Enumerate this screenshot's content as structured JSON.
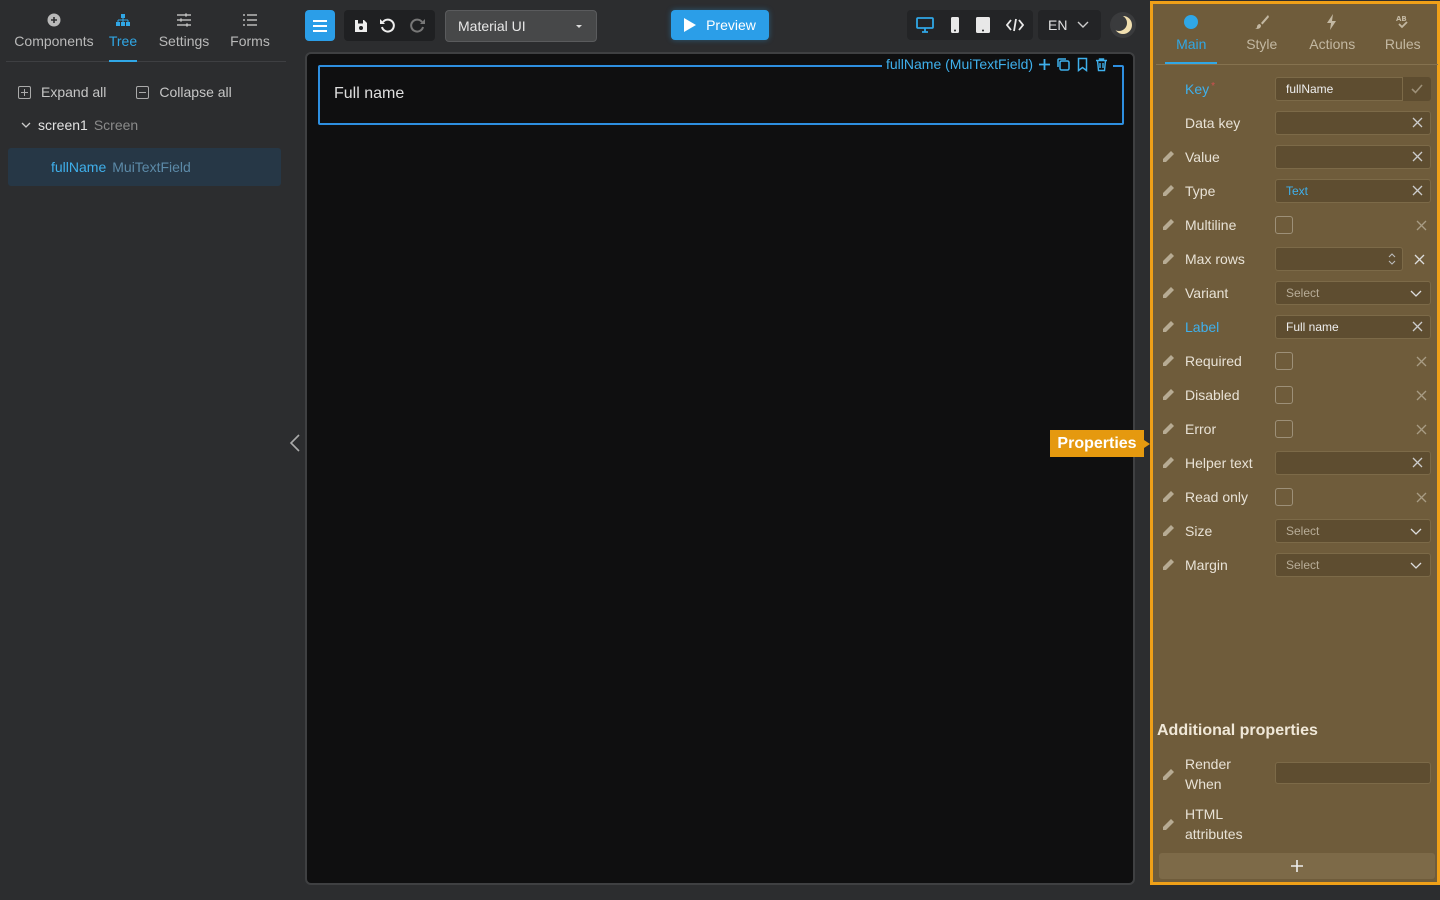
{
  "left_tabs": [
    {
      "label": "Components",
      "icon": "plus-circle-icon"
    },
    {
      "label": "Tree",
      "icon": "tree-icon",
      "active": true
    },
    {
      "label": "Settings",
      "icon": "sliders-icon"
    },
    {
      "label": "Forms",
      "icon": "list-icon"
    }
  ],
  "tree": {
    "expand_all": "Expand all",
    "collapse_all": "Collapse all",
    "screen": {
      "name": "screen1",
      "type": "Screen"
    },
    "field": {
      "name": "fullName",
      "type": "MuiTextField"
    }
  },
  "toolbar": {
    "library": "Material UI",
    "preview": "Preview",
    "language": "EN"
  },
  "canvas": {
    "field_label": "Full name",
    "selected_caption": "fullName (MuiTextField)"
  },
  "properties_tag": "Properties",
  "right_tabs": [
    {
      "label": "Main",
      "icon": "dot-icon",
      "active": true
    },
    {
      "label": "Style",
      "icon": "brush-icon"
    },
    {
      "label": "Actions",
      "icon": "bolt-icon"
    },
    {
      "label": "Rules",
      "icon": "rules-icon"
    }
  ],
  "props": {
    "key": {
      "label": "Key",
      "value": "fullName"
    },
    "data_key": {
      "label": "Data key",
      "value": ""
    },
    "value": {
      "label": "Value",
      "value": ""
    },
    "type": {
      "label": "Type",
      "value": "Text"
    },
    "multiline": {
      "label": "Multiline"
    },
    "max_rows": {
      "label": "Max rows",
      "value": ""
    },
    "variant": {
      "label": "Variant",
      "value": "Select"
    },
    "label": {
      "label": "Label",
      "value": "Full name"
    },
    "required": {
      "label": "Required"
    },
    "disabled": {
      "label": "Disabled"
    },
    "error": {
      "label": "Error"
    },
    "helper_text": {
      "label": "Helper text",
      "value": ""
    },
    "read_only": {
      "label": "Read only"
    },
    "size": {
      "label": "Size",
      "value": "Select"
    },
    "margin": {
      "label": "Margin",
      "value": "Select"
    }
  },
  "additional": {
    "title": "Additional properties",
    "render_when_1": "Render",
    "render_when_2": "When",
    "html_attrs_1": "HTML",
    "html_attrs_2": "attributes"
  },
  "colors": {
    "accent": "#2b9ee8",
    "highlight": "#efa018",
    "panel": "#6f5c3b"
  }
}
